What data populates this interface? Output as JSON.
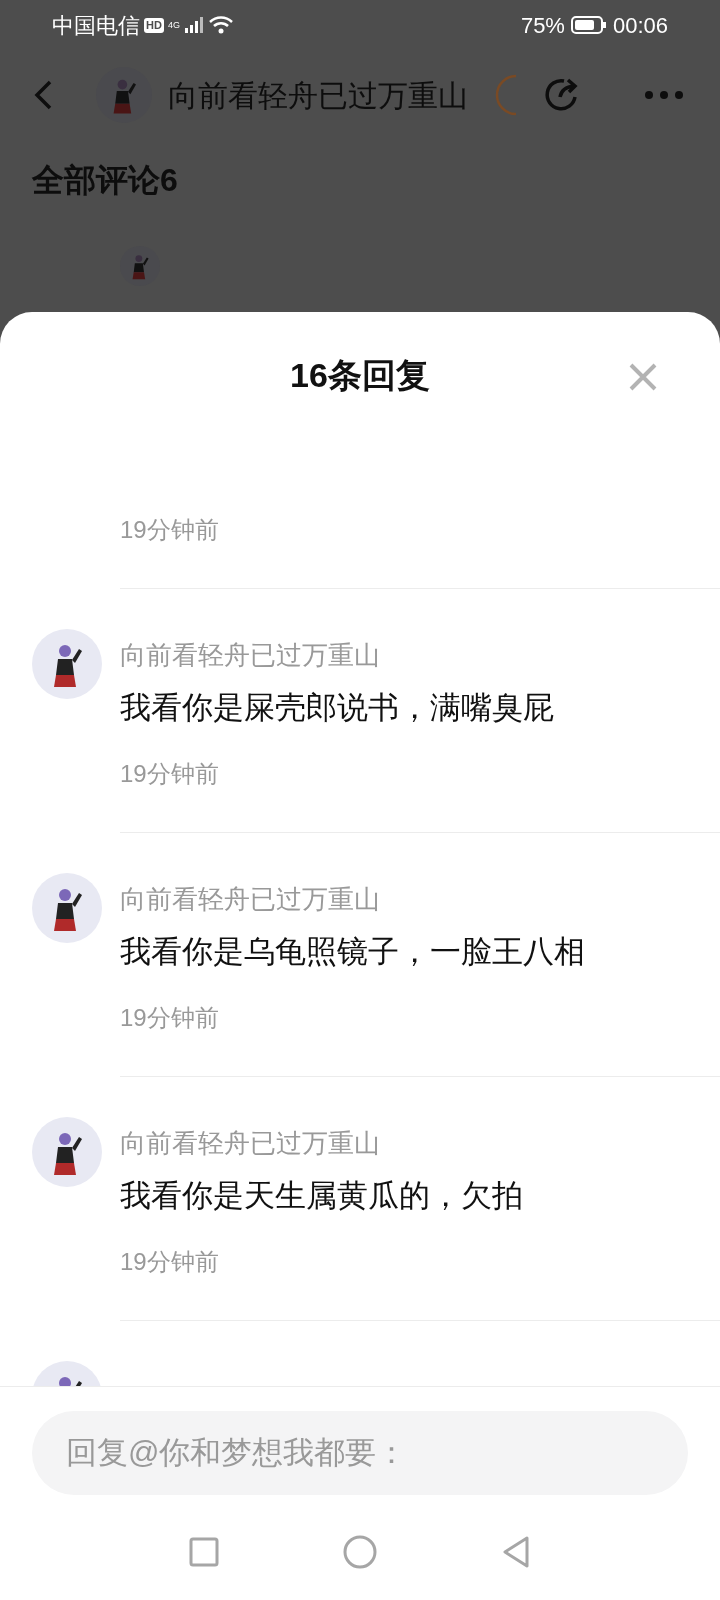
{
  "status_bar": {
    "carrier": "中国电信",
    "hd": "HD",
    "network": "4G",
    "battery": "75%",
    "time": "00:06"
  },
  "header": {
    "title": "向前看轻舟已过万重山"
  },
  "comments_heading": "全部评论6",
  "sheet": {
    "title": "16条回复"
  },
  "replies": [
    {
      "time": "19分钟前"
    },
    {
      "author": "向前看轻舟已过万重山",
      "text": "我看你是屎壳郎说书，满嘴臭屁",
      "time": "19分钟前"
    },
    {
      "author": "向前看轻舟已过万重山",
      "text": "我看你是乌龟照镜子，一脸王八相",
      "time": "19分钟前"
    },
    {
      "author": "向前看轻舟已过万重山",
      "text": "我看你是天生属黄瓜的，欠拍",
      "time": "19分钟前"
    }
  ],
  "reply_field": {
    "placeholder": "回复@你和梦想我都要："
  }
}
